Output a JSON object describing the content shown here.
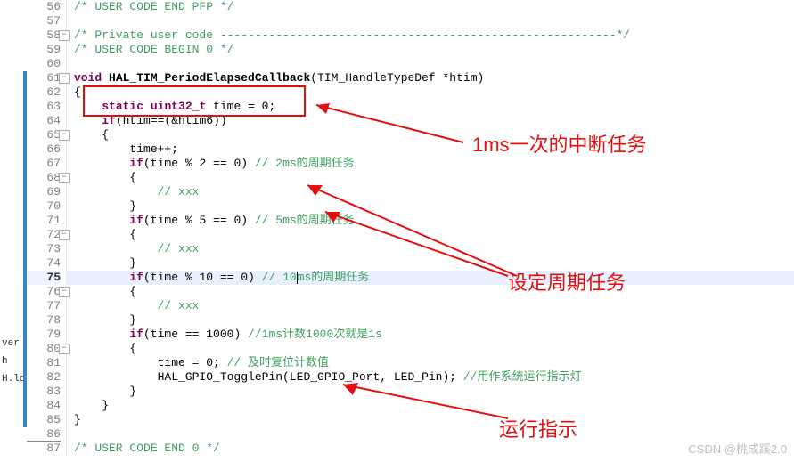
{
  "sidebar": {
    "item1": "ver",
    "item2": "h",
    "item3": "H.ld"
  },
  "gutter": {
    "lines": [
      56,
      57,
      58,
      59,
      60,
      61,
      62,
      63,
      64,
      65,
      66,
      67,
      68,
      69,
      70,
      71,
      72,
      73,
      74,
      75,
      76,
      77,
      78,
      79,
      80,
      81,
      82,
      83,
      84,
      85,
      86,
      87
    ]
  },
  "code": {
    "l56_cm": "USER CODE END PFP */",
    "l58_cm": "/* Private user code ---------------------------------------------------------*/",
    "l59_cm": "/* USER CODE BEGIN 0 */",
    "l61_kw": "void",
    "l61_fn": "HAL_TIM_PeriodElapsedCallback",
    "l61_arg": "(TIM_HandleTypeDef *htim)",
    "l62": "{",
    "l63_kw": "static",
    "l63_ty": "uint32_t",
    "l63_rest": " time = 0;",
    "l64_kw": "if",
    "l64_rest": "(htim==(&htim6))",
    "l65": "    {",
    "l66": "        time++;",
    "l67_kw": "if",
    "l67_cond": "(time % 2 == 0)",
    "l67_cm": " // 2ms的周期任务",
    "l68": "        {",
    "l69_cm": "// xxx",
    "l70": "        }",
    "l71_kw": "if",
    "l71_cond": "(time % 5 == 0)",
    "l71_cm": " // 5ms的周期任务",
    "l72": "        {",
    "l73_cm": "// xxx",
    "l74": "        }",
    "l75_kw": "if",
    "l75_cond_a": "(time % 10 == 0)",
    "l75_cm_a": " // 10",
    "l75_cm_b": "ms的周期任务",
    "l76": "        {",
    "l77_cm": "// xxx",
    "l78": "        }",
    "l79_kw": "if",
    "l79_cond": "(time == 1000)",
    "l79_cm": " //1ms计数1000次就是1s",
    "l80": "        {",
    "l81_a": "            time = 0;",
    "l81_cm": " // 及时复位计数值",
    "l82_a": "            HAL_GPIO_TogglePin(LED_GPIO_Port, LED_Pin);",
    "l82_cm": " //用作系统运行指示灯",
    "l83": "        }",
    "l84": "    }",
    "l85": "}",
    "l87_cm": "/* USER CODE END 0 */"
  },
  "annotations": {
    "a1": "1ms一次的中断任务",
    "a2": "设定周期任务",
    "a3": "运行指示"
  },
  "watermark": "CSDN @桃成蹊2.0"
}
